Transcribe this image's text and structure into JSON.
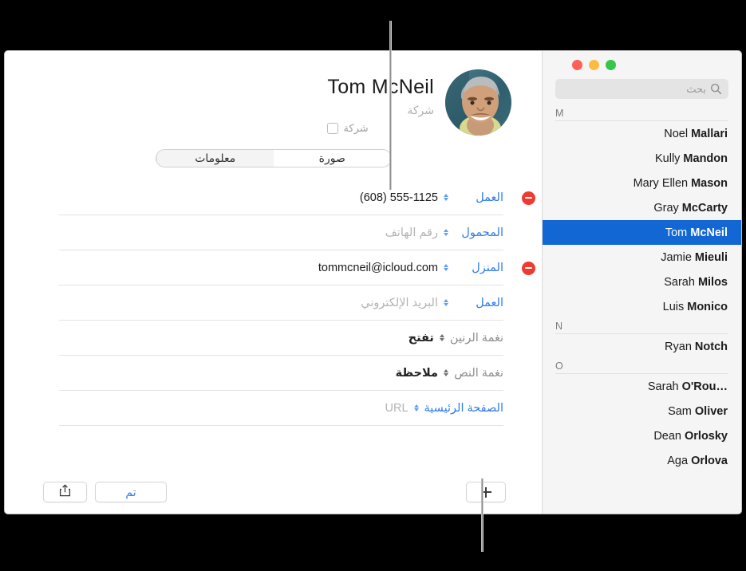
{
  "window": {
    "traffic_lights": [
      "close",
      "minimize",
      "zoom"
    ]
  },
  "sidebar": {
    "search": {
      "placeholder": "بحث",
      "icon": "search-icon",
      "value": ""
    },
    "groups": [
      {
        "letter": "M",
        "contacts": [
          {
            "first": "Noel",
            "last": "Mallari",
            "selected": false
          },
          {
            "first": "Kully",
            "last": "Mandon",
            "selected": false
          },
          {
            "first": "Mary Ellen",
            "last": "Mason",
            "selected": false
          },
          {
            "first": "Gray",
            "last": "McCarty",
            "selected": false
          },
          {
            "first": "Tom",
            "last": "McNeil",
            "selected": true
          },
          {
            "first": "Jamie",
            "last": "Mieuli",
            "selected": false
          },
          {
            "first": "Sarah",
            "last": "Milos",
            "selected": false
          },
          {
            "first": "Luis",
            "last": "Monico",
            "selected": false
          }
        ]
      },
      {
        "letter": "N",
        "contacts": [
          {
            "first": "Ryan",
            "last": "Notch",
            "selected": false
          }
        ]
      },
      {
        "letter": "O",
        "contacts": [
          {
            "first": "Sarah",
            "last": "O'Rou…",
            "selected": false
          },
          {
            "first": "Sam",
            "last": "Oliver",
            "selected": false
          },
          {
            "first": "Dean",
            "last": "Orlosky",
            "selected": false
          },
          {
            "first": "Aga",
            "last": "Orlova",
            "selected": false
          }
        ]
      }
    ]
  },
  "detail": {
    "name": "Tom  McNeil",
    "company_placeholder": "شركة",
    "company_checkbox_label": "شركة",
    "company_checkbox_checked": false,
    "avatar_alt": "صورة جهة الاتصال",
    "tabs": [
      {
        "id": "picture",
        "label": "صورة",
        "active": true
      },
      {
        "id": "info",
        "label": "معلومات",
        "active": false
      }
    ],
    "fields": [
      {
        "id": "phone-work",
        "label": "العمل",
        "label_color": "blue",
        "value": "(608) 555-1125",
        "is_placeholder": false,
        "value_dir": "ltr",
        "has_remove": true
      },
      {
        "id": "phone-mobile",
        "label": "المحمول",
        "label_color": "blue",
        "value": "رقم الهاتف",
        "is_placeholder": true,
        "value_dir": "rtl",
        "has_remove": false
      },
      {
        "id": "email-home",
        "label": "المنزل",
        "label_color": "blue",
        "value": "tommcneil@icloud.com",
        "is_placeholder": false,
        "value_dir": "ltr",
        "has_remove": true
      },
      {
        "id": "email-work",
        "label": "العمل",
        "label_color": "blue",
        "value": "البريد الإلكتروني",
        "is_placeholder": true,
        "value_dir": "rtl",
        "has_remove": false
      },
      {
        "id": "ringtone",
        "label": "نغمة الرنين",
        "label_color": "gray",
        "value": "تفتح",
        "is_placeholder": false,
        "value_dir": "rtl",
        "has_remove": false
      },
      {
        "id": "text-tone",
        "label": "نغمة النص",
        "label_color": "gray",
        "value": "ملاحظة",
        "is_placeholder": false,
        "value_dir": "rtl",
        "has_remove": false
      },
      {
        "id": "homepage",
        "label": "الصفحة الرئيسية",
        "label_color": "blue",
        "value": "URL",
        "is_placeholder": true,
        "value_dir": "ltr",
        "has_remove": false
      }
    ],
    "bottom": {
      "share_icon": "share-icon",
      "done_label": "تم",
      "add_icon": "plus-icon"
    }
  },
  "colors": {
    "selection_blue": "#1367d5",
    "link_blue": "#2f7ced",
    "remove_red": "#ee3b30",
    "placeholder_gray": "#b3b3b3",
    "sidebar_bg": "#f5f5f5",
    "backdrop": "#000000"
  }
}
